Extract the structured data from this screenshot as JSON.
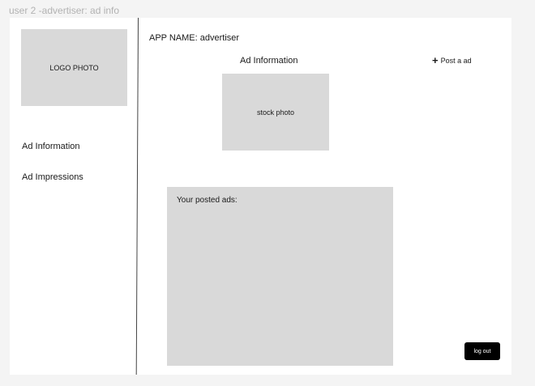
{
  "frame": {
    "title": "user 2 -advertiser: ad info"
  },
  "sidebar": {
    "logo_label": "LOGO PHOTO",
    "items": [
      {
        "label": "Ad Information"
      },
      {
        "label": "Ad Impressions"
      }
    ]
  },
  "header": {
    "app_name": "APP NAME: advertiser"
  },
  "main": {
    "section_title": "Ad Information",
    "post_ad_label": "Post a ad",
    "post_ad_icon": "plus-icon",
    "stock_photo_label": "stock photo",
    "posted_ads_label": "Your posted ads:",
    "logout_label": "log out"
  },
  "colors": {
    "placeholder": "#d9d9d9",
    "logout_bg": "#000000",
    "frame_bg": "#ffffff",
    "canvas_bg": "#f4f4f4"
  }
}
